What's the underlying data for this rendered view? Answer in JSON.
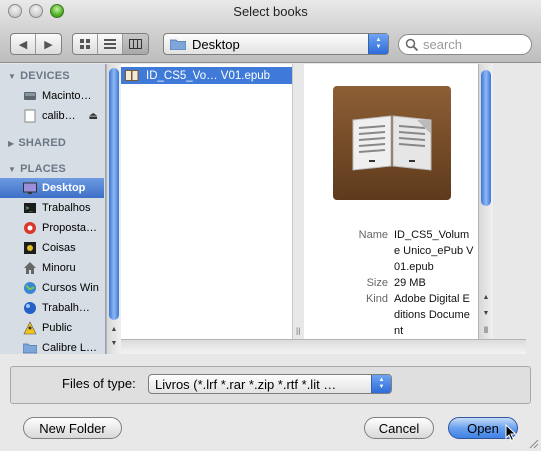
{
  "window": {
    "title": "Select books"
  },
  "toolbar": {
    "back_icon": "back-arrow-icon",
    "forward_icon": "forward-arrow-icon",
    "view_modes": [
      "icon-view",
      "list-view",
      "column-view"
    ],
    "active_view": "column-view",
    "location": "Desktop",
    "search_placeholder": "search"
  },
  "sidebar": {
    "sections": [
      {
        "title": "DEVICES",
        "items": [
          {
            "label": "Macinto…",
            "icon": "hard-disk-icon"
          },
          {
            "label": "calib…",
            "icon": "disk-image-icon",
            "eject": "⏏"
          }
        ]
      },
      {
        "title": "SHARED",
        "items": []
      },
      {
        "title": "PLACES",
        "items": [
          {
            "label": "Desktop",
            "icon": "desktop-icon",
            "selected": true
          },
          {
            "label": "Trabalhos",
            "icon": "terminal-folder-icon"
          },
          {
            "label": "Proposta…",
            "icon": "app-red-icon"
          },
          {
            "label": "Coisas",
            "icon": "coisas-icon"
          },
          {
            "label": "Minoru",
            "icon": "home-icon"
          },
          {
            "label": "Cursos Win",
            "icon": "globe-icon"
          },
          {
            "label": "Trabalh…",
            "icon": "globe-blue-icon"
          },
          {
            "label": "Public",
            "icon": "public-folder-icon"
          },
          {
            "label": "Calibre L…",
            "icon": "folder-icon"
          }
        ]
      }
    ]
  },
  "browser": {
    "files": [
      {
        "name": "ID_CS5_Vo… V01.epub",
        "selected": true
      }
    ]
  },
  "preview": {
    "fields": [
      {
        "key": "Name",
        "value": "ID_CS5_Volume Unico_ePub V01.epub"
      },
      {
        "key": "Size",
        "value": "29 MB"
      },
      {
        "key": "Kind",
        "value": "Adobe Digital Editions Document"
      }
    ]
  },
  "filter": {
    "label": "Files of type:",
    "value": "Livros (*.lrf *.rar *.zip *.rtf *.lit …"
  },
  "buttons": {
    "new_folder": "New Folder",
    "cancel": "Cancel",
    "open": "Open"
  }
}
